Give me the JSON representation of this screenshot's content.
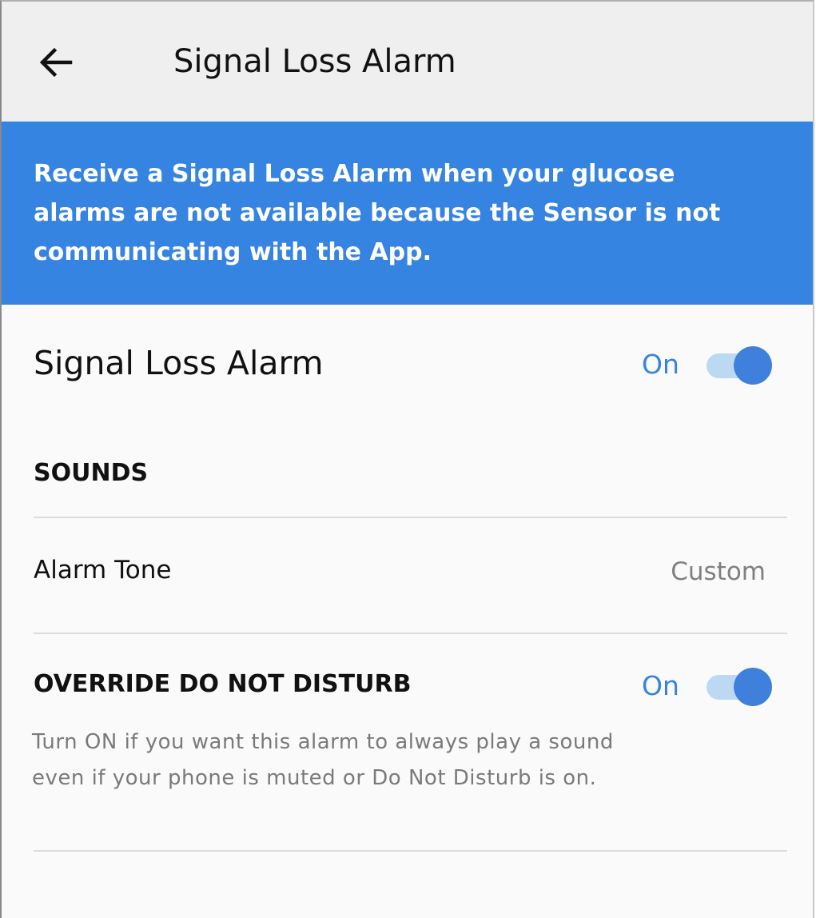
{
  "appbar": {
    "title": "Signal Loss Alarm",
    "back_icon": "arrow-left-icon"
  },
  "banner": {
    "text": "Receive a Signal Loss Alarm when your glucose alarms are not available because the Sensor is not communicating with the App.",
    "background_color": "#3684e2"
  },
  "signal_loss": {
    "label": "Signal Loss Alarm",
    "state_label": "On",
    "enabled": true
  },
  "sounds": {
    "header": "SOUNDS",
    "alarm_tone": {
      "label": "Alarm Tone",
      "value": "Custom"
    }
  },
  "override_dnd": {
    "header": "OVERRIDE DO NOT DISTURB",
    "state_label": "On",
    "enabled": true,
    "description": "Turn ON if you want this alarm to always play a sound even if your phone is muted or Do Not Disturb is on."
  },
  "colors": {
    "accent": "#3684e2",
    "toggle_track": "#bcd9f4",
    "appbar_bg": "#efefef"
  }
}
